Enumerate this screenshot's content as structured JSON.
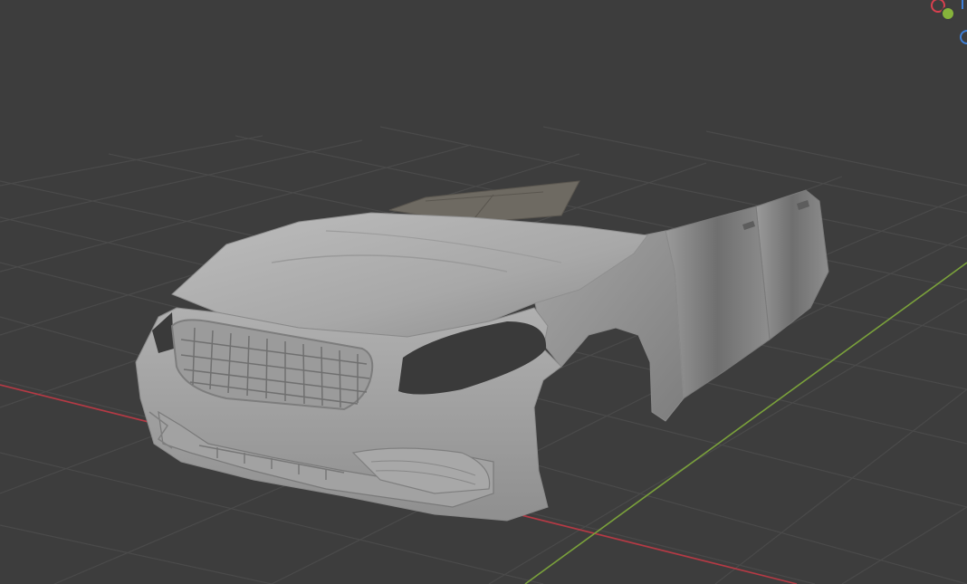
{
  "viewport": {
    "background_color": "#3d3d3d",
    "grid_color": "#4a4a4a",
    "x_axis_color": "#b53a45",
    "y_axis_color": "#7aa13b",
    "model_color": "#a9a9a9",
    "model_name": "car-front-body"
  },
  "gizmo": {
    "axes": [
      {
        "name": "x-axis-icon",
        "color": "#d9404f"
      },
      {
        "name": "y-axis-icon",
        "color": "#86b33b"
      },
      {
        "name": "z-axis-icon",
        "color": "#3f7fd6"
      }
    ]
  }
}
